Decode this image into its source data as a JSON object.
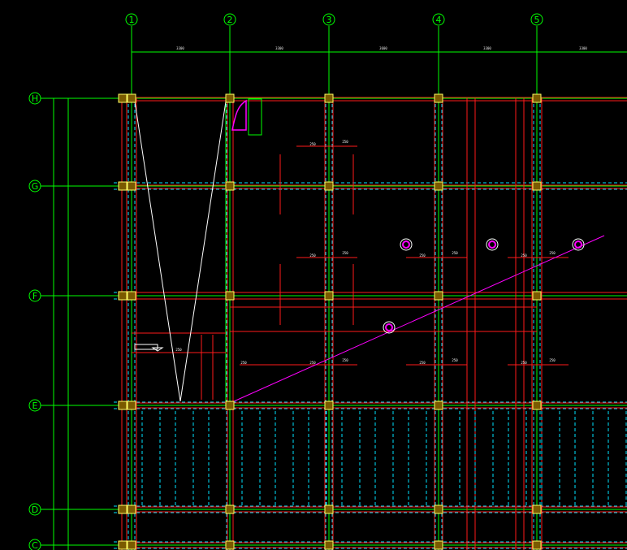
{
  "drawing": {
    "colors": {
      "background": "#000000",
      "axis": "#00ff00",
      "beam_main": "#ff1a1a",
      "beam_dashed": "#00e5ff",
      "column_fill": "#7a5a00",
      "column_stroke": "#ffff66",
      "diagonal": "#ff00ff",
      "annotation": "#ffffff"
    },
    "column_axes": [
      "1",
      "2",
      "3",
      "4",
      "5"
    ],
    "row_axes": [
      "H",
      "G",
      "F",
      "E",
      "D",
      "C"
    ]
  }
}
